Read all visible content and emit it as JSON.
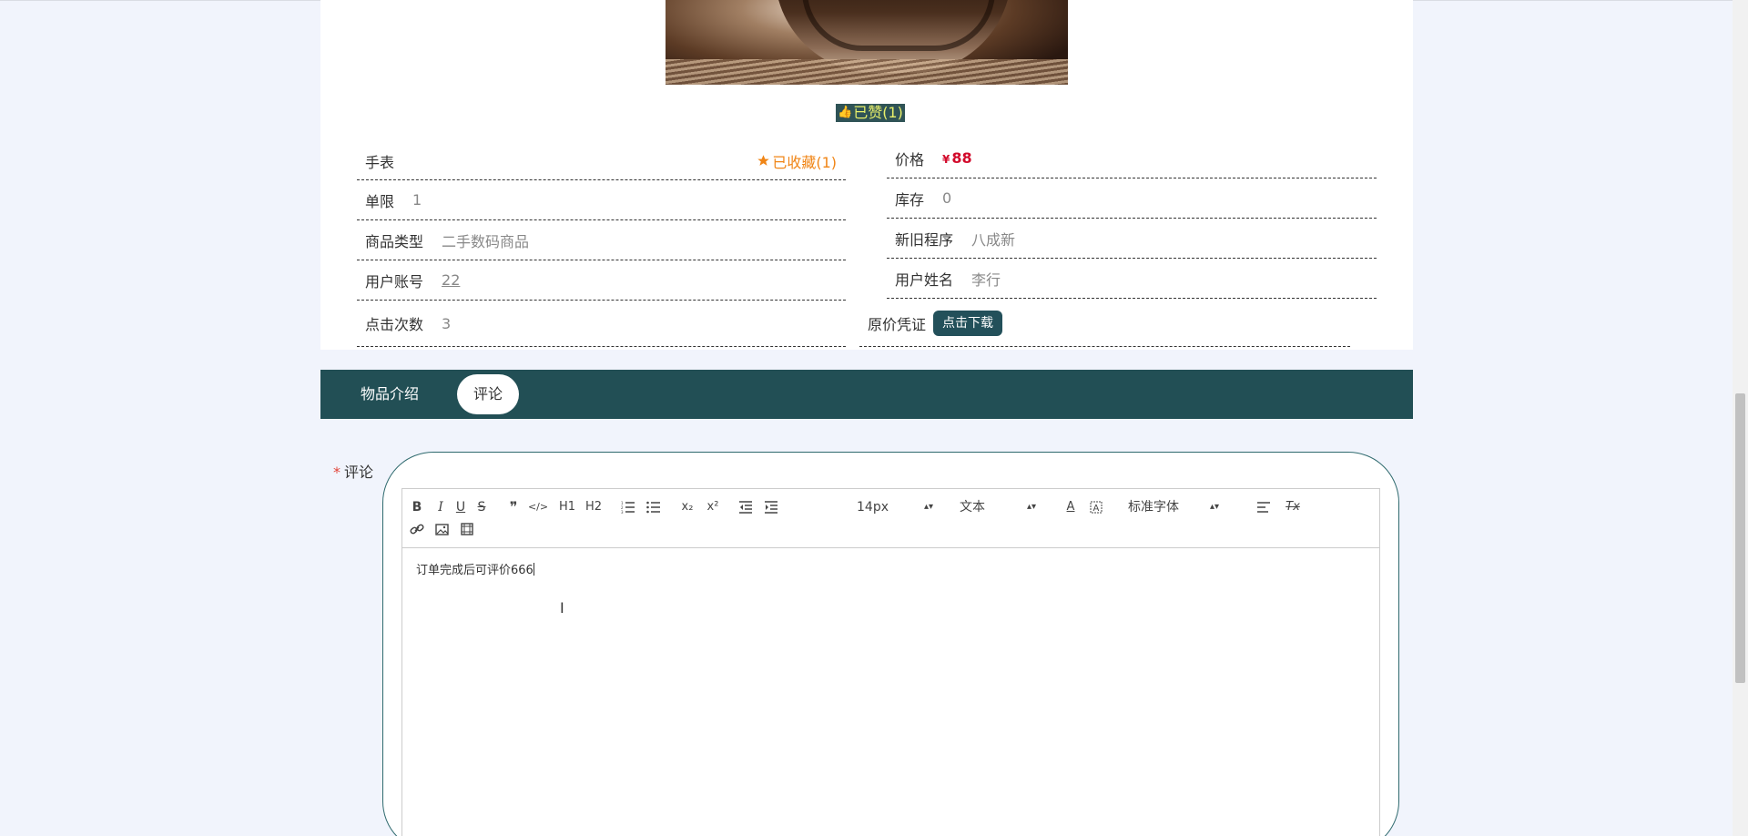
{
  "product": {
    "like_label": "已赞(1)",
    "name": "手表",
    "favorite_label": "已收藏(1)"
  },
  "details": {
    "price_label": "价格",
    "price_currency": "¥",
    "price_value": "88",
    "limit_label": "单限",
    "limit_value": "1",
    "stock_label": "库存",
    "stock_value": "0",
    "category_label": "商品类型",
    "category_value": "二手数码商品",
    "condition_label": "新旧程序",
    "condition_value": "八成新",
    "account_label": "用户账号",
    "account_value": "22",
    "username_label": "用户姓名",
    "username_value": "李行",
    "clicks_label": "点击次数",
    "clicks_value": "3",
    "voucher_label": "原价凭证",
    "download_label": "点击下载"
  },
  "tabs": [
    {
      "label": "物品介绍",
      "active": false
    },
    {
      "label": "评论",
      "active": true
    }
  ],
  "comment": {
    "required_mark": "*",
    "label": "评论",
    "content": "订单完成后可评价666"
  },
  "toolbar": {
    "bold": "B",
    "italic": "I",
    "underline": "U",
    "strike": "S",
    "blockquote": "❞",
    "code": "</>",
    "h1": "H1",
    "h2": "H2",
    "subscript": "x₂",
    "superscript": "x²",
    "size_value": "14px",
    "header_value": "文本",
    "font_value": "标准字体",
    "clean": "Tx",
    "color_letter": "A"
  },
  "colors": {
    "accent": "#224f55",
    "price": "#d20a2b",
    "favorite": "#f08516",
    "like_text": "#e8f06a",
    "page_bg": "#f1f4fc"
  }
}
